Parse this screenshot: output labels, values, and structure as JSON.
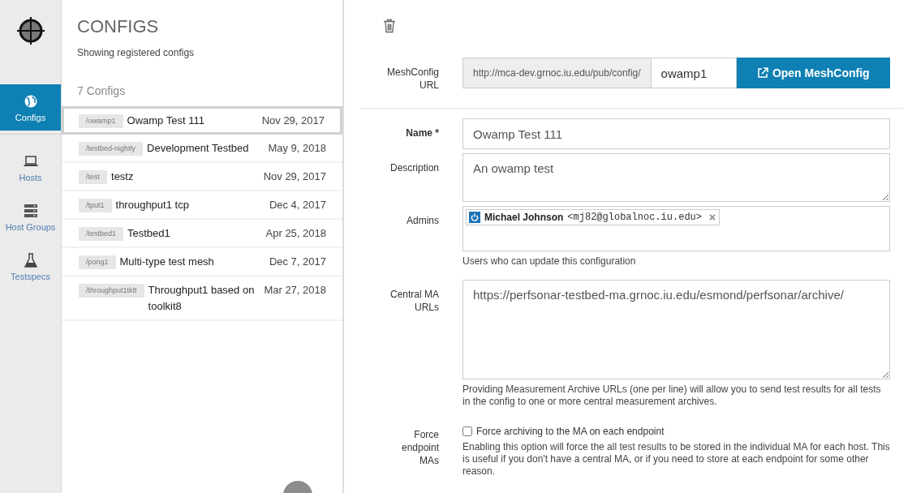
{
  "sidebar": {
    "items": [
      {
        "label": "Configs",
        "selected": true
      },
      {
        "label": "Hosts",
        "selected": false
      },
      {
        "label": "Host Groups",
        "selected": false
      },
      {
        "label": "Testspecs",
        "selected": false
      }
    ]
  },
  "list": {
    "title": "CONFIGS",
    "subtitle": "Showing registered configs",
    "count": "7 Configs",
    "rows": [
      {
        "path": "/owamp1",
        "name": "Owamp Test 111",
        "date": "Nov 29, 2017",
        "selected": true
      },
      {
        "path": "/testbed-nightly",
        "name": "Development Testbed",
        "date": "May 9, 2018",
        "selected": false
      },
      {
        "path": "/test",
        "name": "testz",
        "date": "Nov 29, 2017",
        "selected": false
      },
      {
        "path": "/tput1",
        "name": "throughput1 tcp",
        "date": "Dec 4, 2017",
        "selected": false
      },
      {
        "path": "/testbed1",
        "name": "Testbed1",
        "date": "Apr 25, 2018",
        "selected": false
      },
      {
        "path": "/pong1",
        "name": "Multi-type test mesh",
        "date": "Dec 7, 2017",
        "selected": false
      },
      {
        "path": "/throughput1tk8",
        "name": "Throughput1 based on toolkit8",
        "date": "Mar 27, 2018",
        "selected": false
      }
    ]
  },
  "form": {
    "meshconfig_url": {
      "label": "MeshConfig URL",
      "prefix": "http://mca-dev.grnoc.iu.edu/pub/config/",
      "value": "owamp1",
      "button": "Open MeshConfig"
    },
    "fields": [
      {
        "kind": "input",
        "label": "Name *",
        "required": true,
        "value": "Owamp Test 111"
      },
      {
        "kind": "textarea",
        "label": "Description",
        "value": "An owamp test"
      },
      {
        "kind": "tags",
        "label": "Admins",
        "tags": [
          {
            "name": "Michael Johnson",
            "email": "<mj82@globalnoc.iu.edu>"
          }
        ],
        "help": "Users who can update this configuration"
      },
      {
        "kind": "textarea-large",
        "label": "Central MA URLs",
        "value": "https://perfsonar-testbed-ma.grnoc.iu.edu/esmond/perfsonar/archive/",
        "help": "Providing Measurement Archive URLs (one per line) will allow you to send test results for all tests in the config to one or more central measurement archives."
      },
      {
        "kind": "checkbox",
        "label": "Force endpoint MAs",
        "text": "Force archiving to the MA on each endpoint",
        "checked": false,
        "help": "Enabling this option will force the all test results to be stored in the individual MA for each host. This is useful if you don't have a central MA, or if you need to store at each endpoint for some other reason."
      }
    ]
  }
}
